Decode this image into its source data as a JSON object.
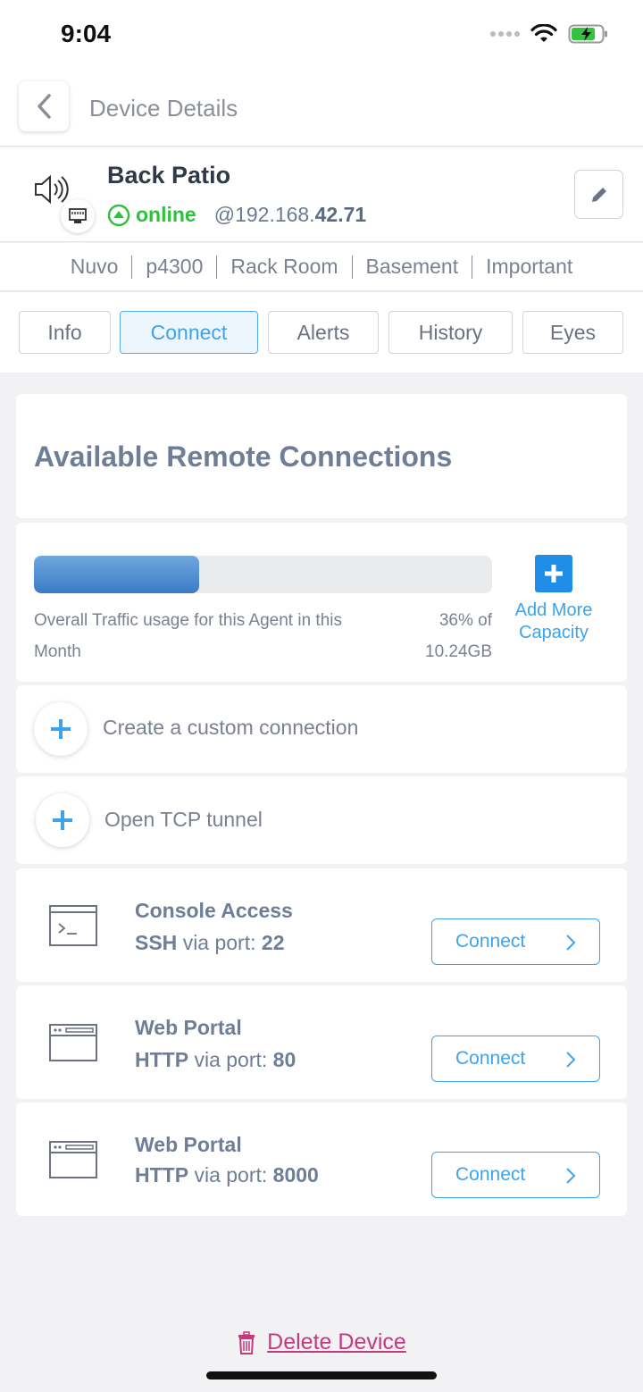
{
  "status_bar": {
    "time": "9:04"
  },
  "header": {
    "title": "Device Details"
  },
  "device": {
    "name": "Back Patio",
    "status": "online",
    "ip_prefix": "@192.168.",
    "ip_suffix": "42.71"
  },
  "tags": [
    "Nuvo",
    "p4300",
    "Rack Room",
    "Basement",
    "Important"
  ],
  "tabs": [
    {
      "label": "Info",
      "active": false
    },
    {
      "label": "Connect",
      "active": true
    },
    {
      "label": "Alerts",
      "active": false
    },
    {
      "label": "History",
      "active": false
    },
    {
      "label": "Eyes",
      "active": false
    }
  ],
  "connections": {
    "title": "Available Remote Connections",
    "usage": {
      "label": "Overall Traffic usage for this Agent in this Month",
      "percent": 36,
      "value_line1": "36% of",
      "value_line2": "10.24GB",
      "add_capacity_line1": "Add More",
      "add_capacity_line2": "Capacity"
    },
    "actions": [
      {
        "label": "Create a custom connection"
      },
      {
        "label": "Open TCP tunnel"
      }
    ],
    "services": [
      {
        "title": "Console Access",
        "protocol": "SSH",
        "via": "via port:",
        "port": "22",
        "button": "Connect",
        "icon": "terminal-icon"
      },
      {
        "title": "Web Portal",
        "protocol": "HTTP",
        "via": "via port:",
        "port": "80",
        "button": "Connect",
        "icon": "browser-window-icon"
      },
      {
        "title": "Web Portal",
        "protocol": "HTTP",
        "via": "via port:",
        "port": "8000",
        "button": "Connect",
        "icon": "browser-window-icon"
      }
    ]
  },
  "footer": {
    "delete_label": "Delete Device"
  },
  "colors": {
    "accent": "#3da3ee",
    "online": "#2ec23a",
    "danger": "#c43a7e",
    "heading": "#6e7e96"
  }
}
